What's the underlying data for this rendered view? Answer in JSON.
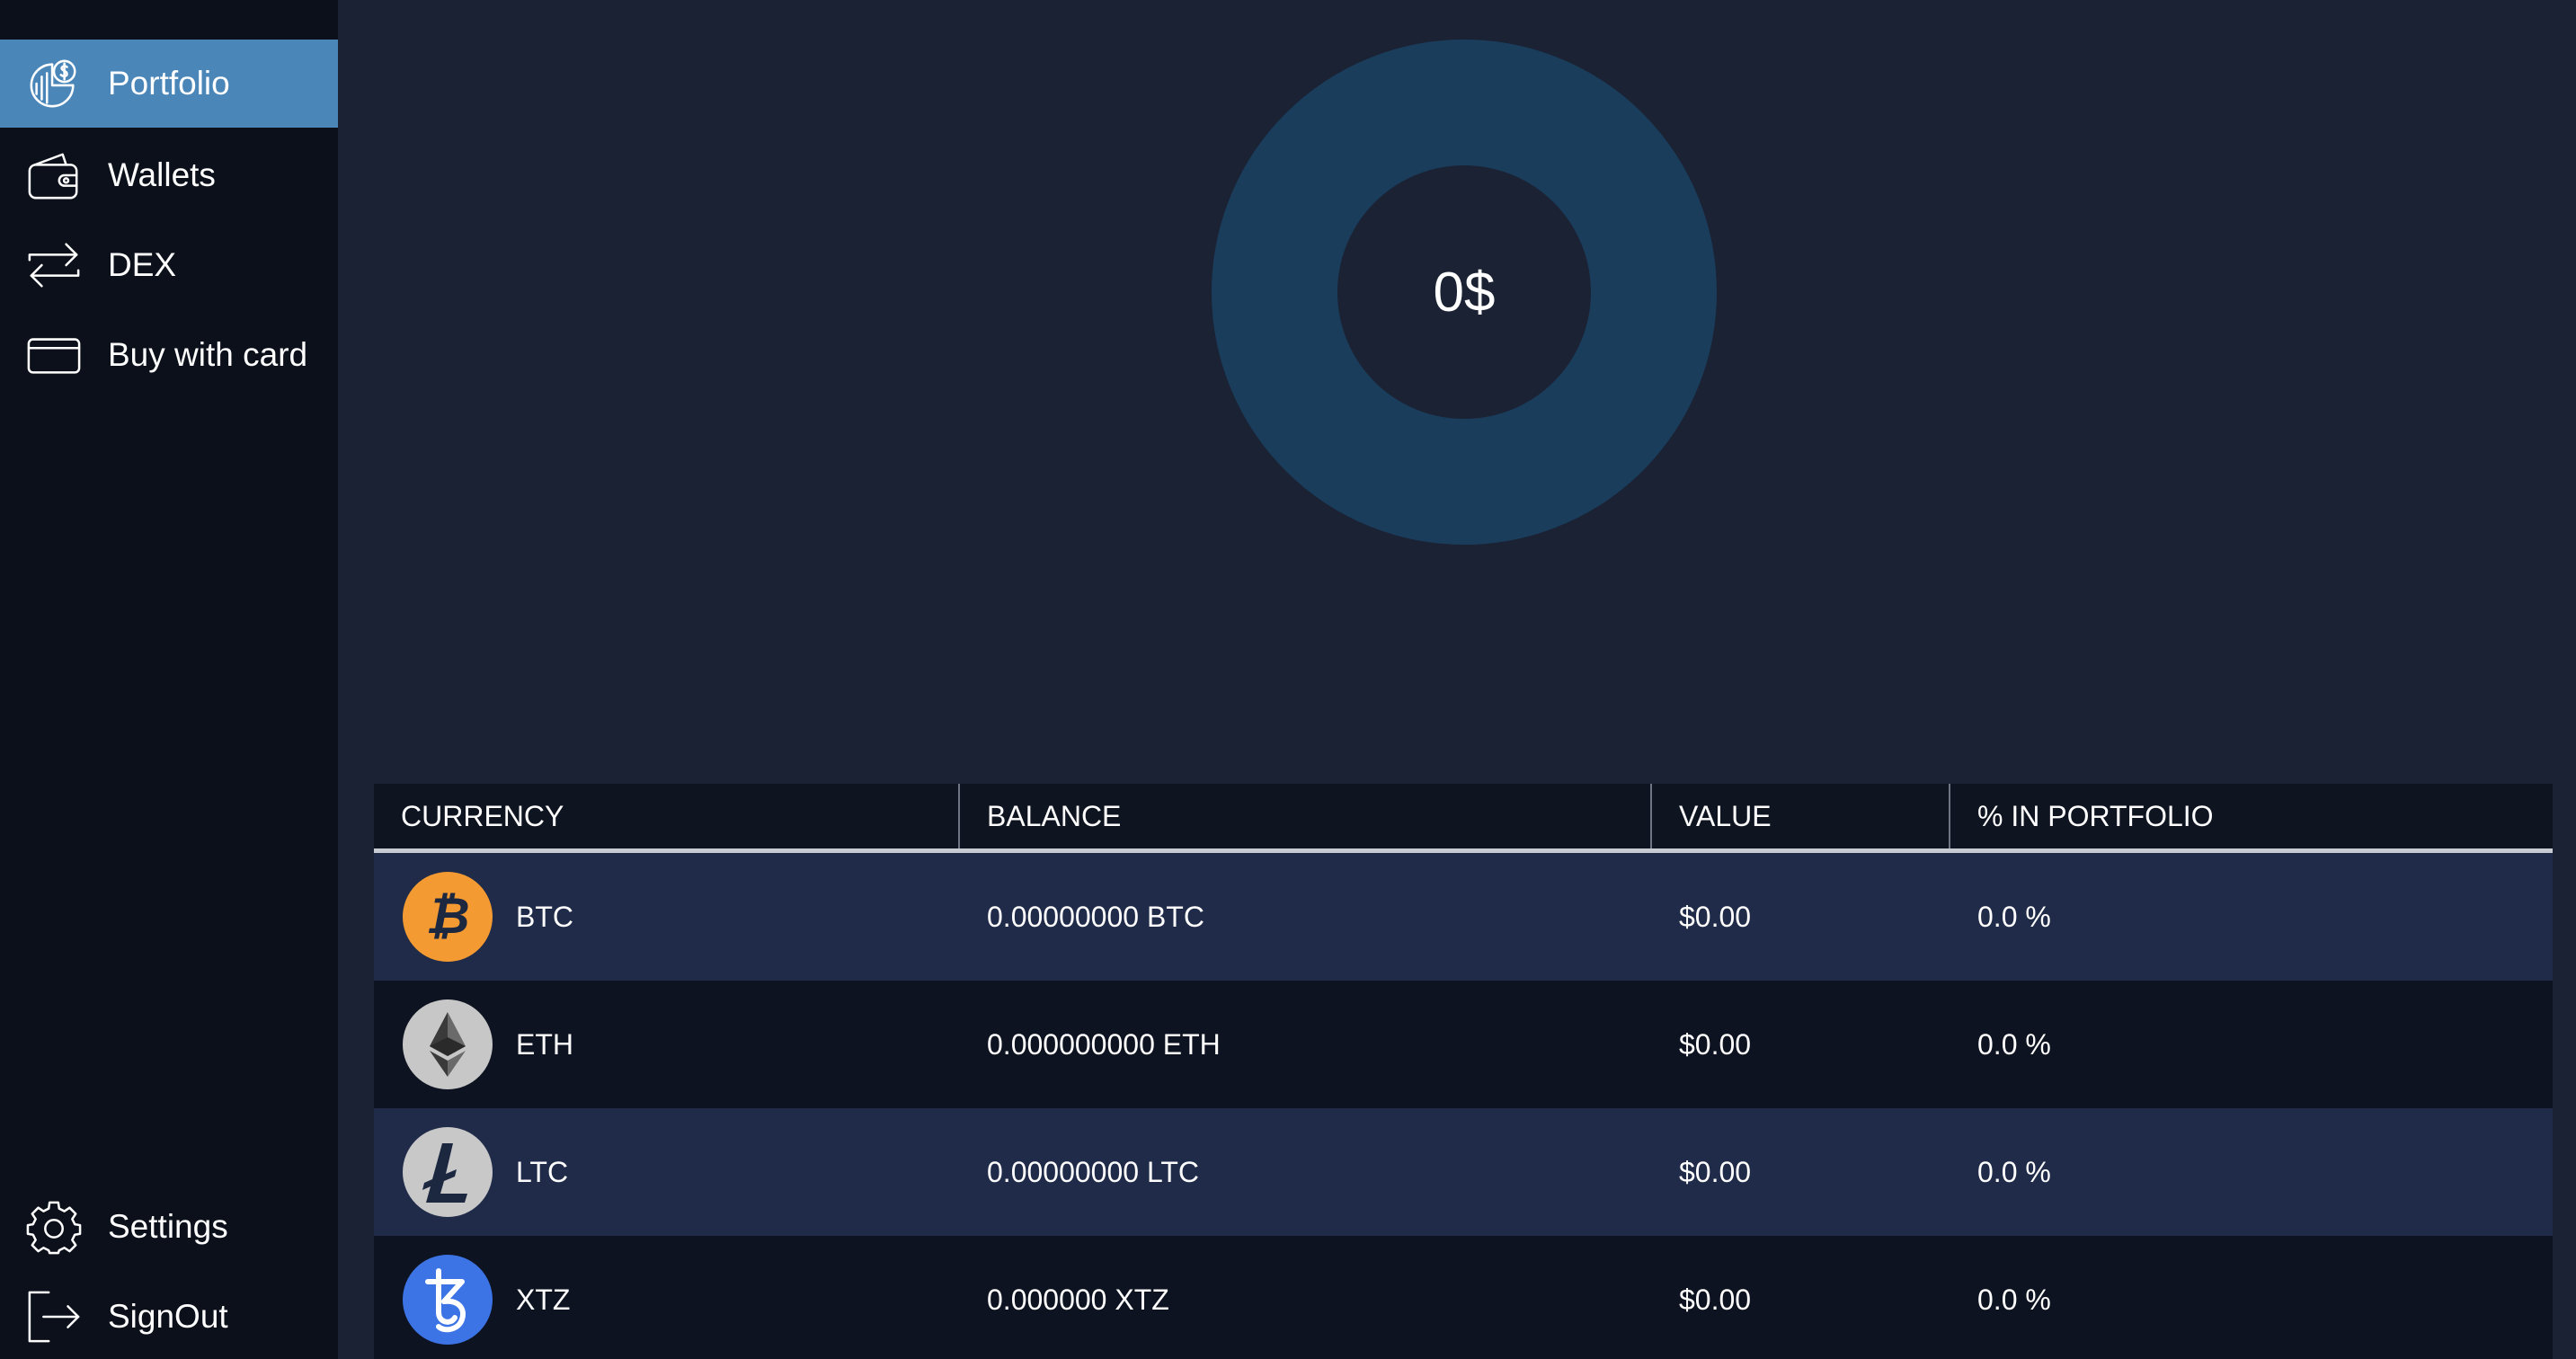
{
  "sidebar": {
    "top_items": [
      {
        "label": "Portfolio",
        "icon": "portfolio-icon",
        "active": true
      },
      {
        "label": "Wallets",
        "icon": "wallet-icon",
        "active": false
      },
      {
        "label": "DEX",
        "icon": "exchange-arrows-icon",
        "active": false
      },
      {
        "label": "Buy with card",
        "icon": "credit-card-icon",
        "active": false
      }
    ],
    "bottom_items": [
      {
        "label": "Settings",
        "icon": "gear-icon"
      },
      {
        "label": "SignOut",
        "icon": "sign-out-icon"
      }
    ]
  },
  "chart_data": {
    "type": "pie",
    "categories": [],
    "values": [],
    "center_label": "0$"
  },
  "table": {
    "headers": [
      "CURRENCY",
      "BALANCE",
      "VALUE",
      "% IN PORTFOLIO"
    ],
    "rows": [
      {
        "code": "BTC",
        "icon": "bitcoin-icon",
        "balance": "0.00000000 BTC",
        "value": "$0.00",
        "percent": "0.0 %"
      },
      {
        "code": "ETH",
        "icon": "ethereum-icon",
        "balance": "0.000000000 ETH",
        "value": "$0.00",
        "percent": "0.0 %"
      },
      {
        "code": "LTC",
        "icon": "litecoin-icon",
        "balance": "0.00000000 LTC",
        "value": "$0.00",
        "percent": "0.0 %"
      },
      {
        "code": "XTZ",
        "icon": "tezos-icon",
        "balance": "0.000000 XTZ",
        "value": "$0.00",
        "percent": "0.0 %"
      }
    ]
  },
  "colors": {
    "sidebar_bg": "#0c101b",
    "active_item": "#4a86b8",
    "main_bg": "#1a2234",
    "donut_ring": "#1a3d5c",
    "row_highlight": "#1f2b48",
    "row_dark": "#0e1321",
    "bitcoin": "#f39a32",
    "ethereum_bg": "#c7c7c7",
    "litecoin_bg": "#c8c8c8",
    "tezos": "#3c74e6"
  }
}
